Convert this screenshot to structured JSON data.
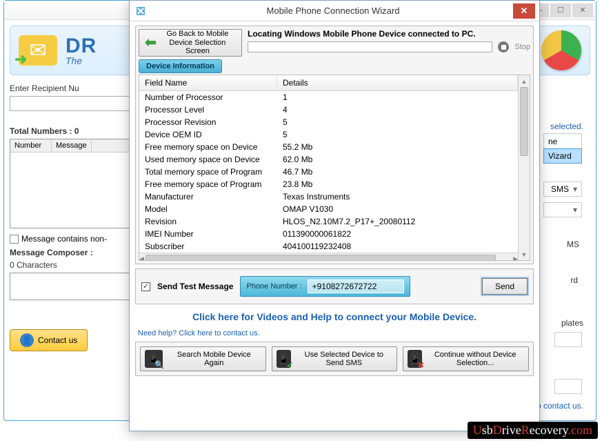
{
  "bg": {
    "logo_text": "DR",
    "logo_sub": "The",
    "recipient_label": "Enter Recipient Nu",
    "total_numbers": "Total Numbers : 0",
    "list_headers": [
      "Number",
      "Message"
    ],
    "msg_non_checkbox": "Message contains non-",
    "composer_label": "Message Composer :",
    "composer_chars": "0 Characters",
    "contact_us": "Contact us",
    "side_selected": "selected.",
    "side_ne": "ne",
    "side_vizard": "Vizard",
    "side_sms1": "SMS",
    "side_ms": "MS",
    "side_rd": "rd",
    "side_plates": "plates",
    "bottom_help": "Need help? Click here to contact us."
  },
  "modal": {
    "title": "Mobile Phone Connection Wizard",
    "back_button": "Go Back to Mobile Device Selection Screen",
    "locating_title": "Locating Windows Mobile Phone Device connected to PC.",
    "stop_label": "Stop",
    "tab": "Device Information",
    "table": {
      "headers": [
        "Field Name",
        "Details"
      ],
      "rows": [
        {
          "field": "Number of Processor",
          "detail": "1"
        },
        {
          "field": "Processor Level",
          "detail": "4"
        },
        {
          "field": "Processor Revision",
          "detail": "5"
        },
        {
          "field": "Device OEM ID",
          "detail": "5"
        },
        {
          "field": "Free memory space on Device",
          "detail": "55.2 Mb"
        },
        {
          "field": "Used memory space on Device",
          "detail": "62.0 Mb"
        },
        {
          "field": "Total memory space of Program",
          "detail": "46.7 Mb"
        },
        {
          "field": "Free memory space of Program",
          "detail": "23.8 Mb"
        },
        {
          "field": "Manufacturer",
          "detail": "Texas Instruments"
        },
        {
          "field": "Model",
          "detail": "OMAP V1030"
        },
        {
          "field": "Revision",
          "detail": "HLOS_N2.10M7.2_P17+_20080112"
        },
        {
          "field": "IMEI Number",
          "detail": "011390000061822"
        },
        {
          "field": "Subscriber",
          "detail": "404100119232408"
        }
      ]
    },
    "send_test": {
      "checkbox_label": "Send Test Message",
      "phone_label": "Phone Number :",
      "phone_value": "+9108272672722",
      "send_button": "Send"
    },
    "help_link": "Click here for Videos and Help to connect your Mobile Device.",
    "small_help": "Need help? Click here to contact us.",
    "bottom_buttons": {
      "search": "Search Mobile Device Again",
      "use": "Use Selected Device to Send SMS",
      "continue": "Continue without Device Selection..."
    }
  },
  "watermark": {
    "first": "U",
    "rest1": "sb",
    "mid": "D",
    "rest2": "rive",
    "mid2": "R",
    "rest3": "ecovery",
    "dot": ".com"
  }
}
